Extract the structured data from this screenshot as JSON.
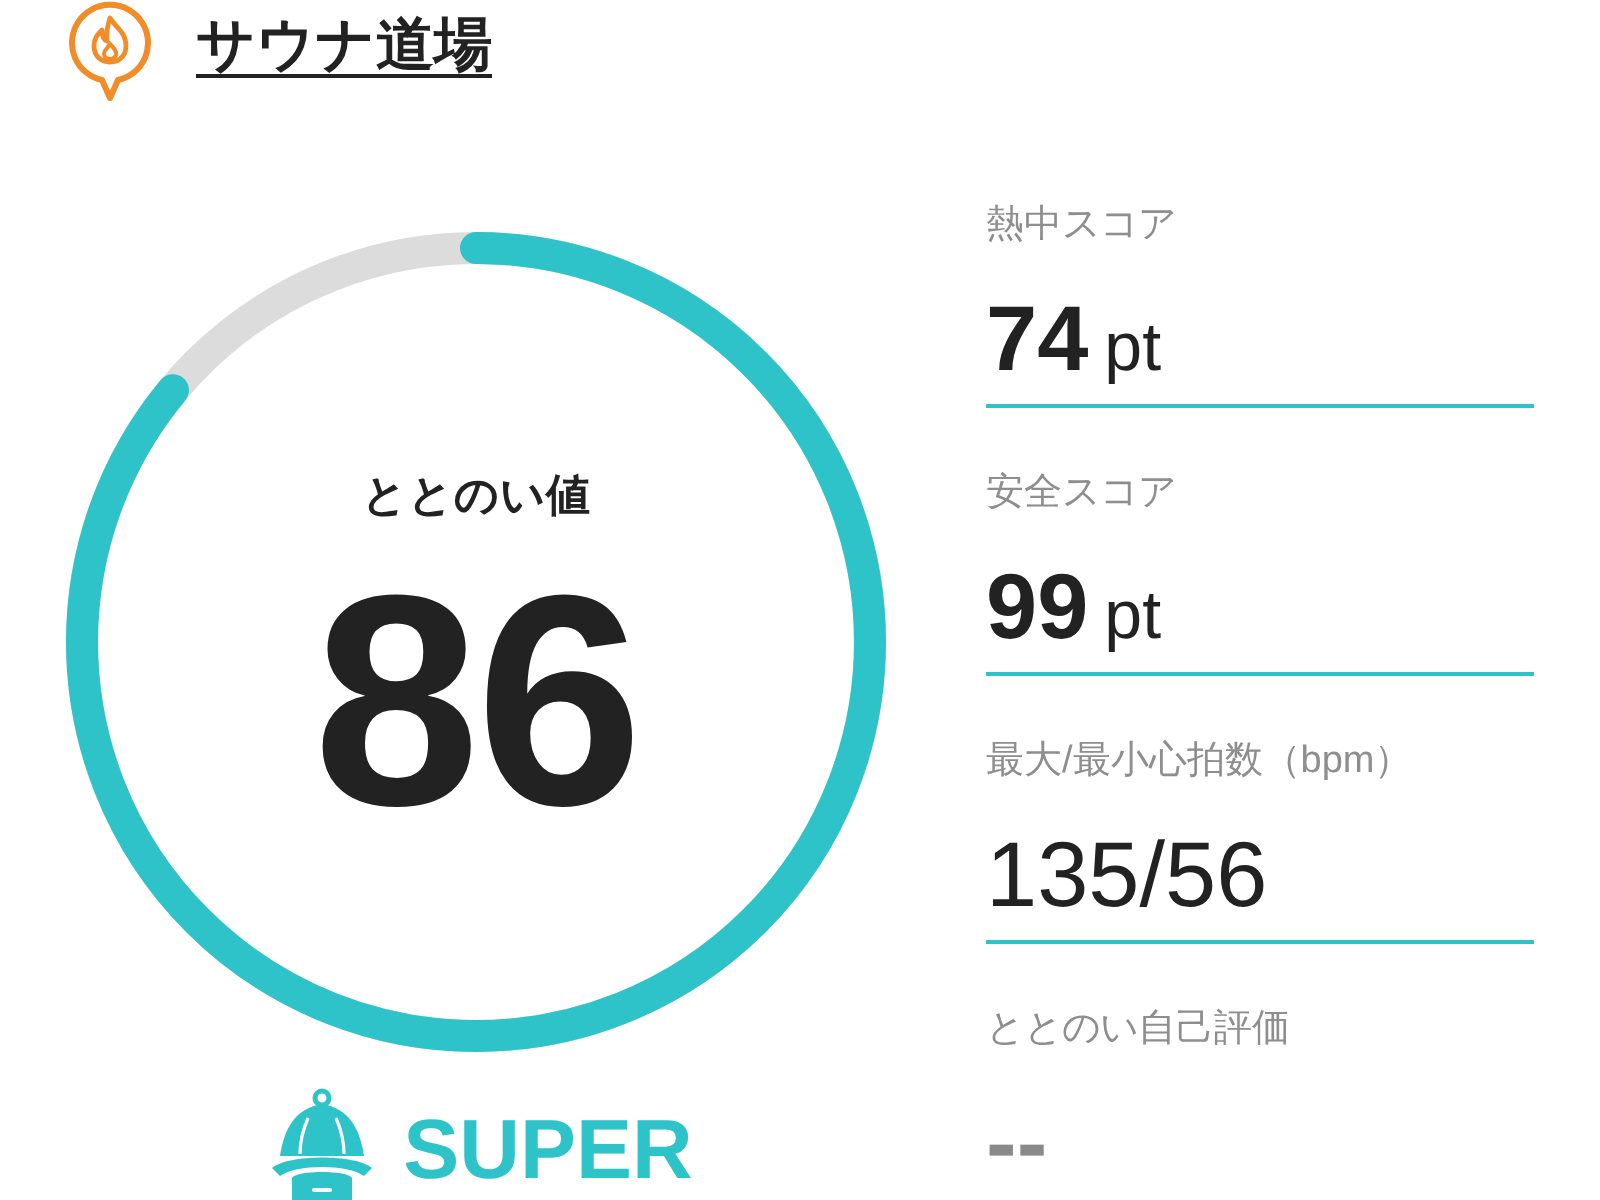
{
  "header": {
    "title": "サウナ道場"
  },
  "gauge": {
    "label": "ととのい値",
    "value": "86",
    "level": 0.86
  },
  "rank": {
    "label": "SUPER"
  },
  "stats": [
    {
      "kind": "score",
      "label": "熱中スコア",
      "value": "74",
      "unit": "pt"
    },
    {
      "kind": "score",
      "label": "安全スコア",
      "value": "99",
      "unit": "pt"
    },
    {
      "kind": "plain",
      "label": "最大/最小心拍数（bpm）",
      "value": "135/56"
    },
    {
      "kind": "empty",
      "label": "ととのい自己評価",
      "value": "--"
    }
  ]
}
